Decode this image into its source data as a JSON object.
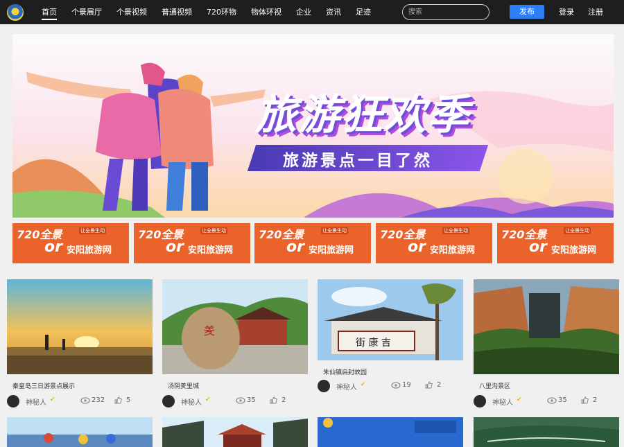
{
  "nav": {
    "items": [
      "首页",
      "个景展厅",
      "个景视频",
      "普通视频",
      "720环物",
      "物体环视",
      "企业",
      "资讯",
      "足迹"
    ],
    "search_placeholder": "搜索",
    "publish": "发布",
    "login": "登录",
    "register": "注册"
  },
  "banner": {
    "title": "旅游狂欢季",
    "subtitle": "旅游景点一目了然"
  },
  "ads": [
    {
      "main": "720全景",
      "or": "or",
      "site": "安阳旅游网",
      "small": "让全景生动"
    },
    {
      "main": "720全景",
      "or": "or",
      "site": "安阳旅游网",
      "small": "让全景生动"
    },
    {
      "main": "720全景",
      "or": "or",
      "site": "安阳旅游网",
      "small": "让全景生动"
    },
    {
      "main": "720全景",
      "or": "or",
      "site": "安阳旅游网",
      "small": "让全景生动"
    },
    {
      "main": "720全景",
      "or": "or",
      "site": "安阳旅游网",
      "small": "让全景生动"
    }
  ],
  "cards": [
    {
      "title": "秦皇岛三日游景点展示",
      "author": "神秘人",
      "views": "232",
      "likes": "5"
    },
    {
      "title": "汤阴羑里城",
      "author": "神秘人",
      "views": "35",
      "likes": "2"
    },
    {
      "title": "朱仙镇启封故园",
      "author": "神秘人",
      "views": "19",
      "likes": "2"
    },
    {
      "title": "八里沟景区",
      "author": "神秘人",
      "views": "35",
      "likes": "2"
    }
  ],
  "colors": {
    "topbar": "#1e1e1e",
    "accent": "#2d7ff9",
    "ad": "#e9632a"
  }
}
